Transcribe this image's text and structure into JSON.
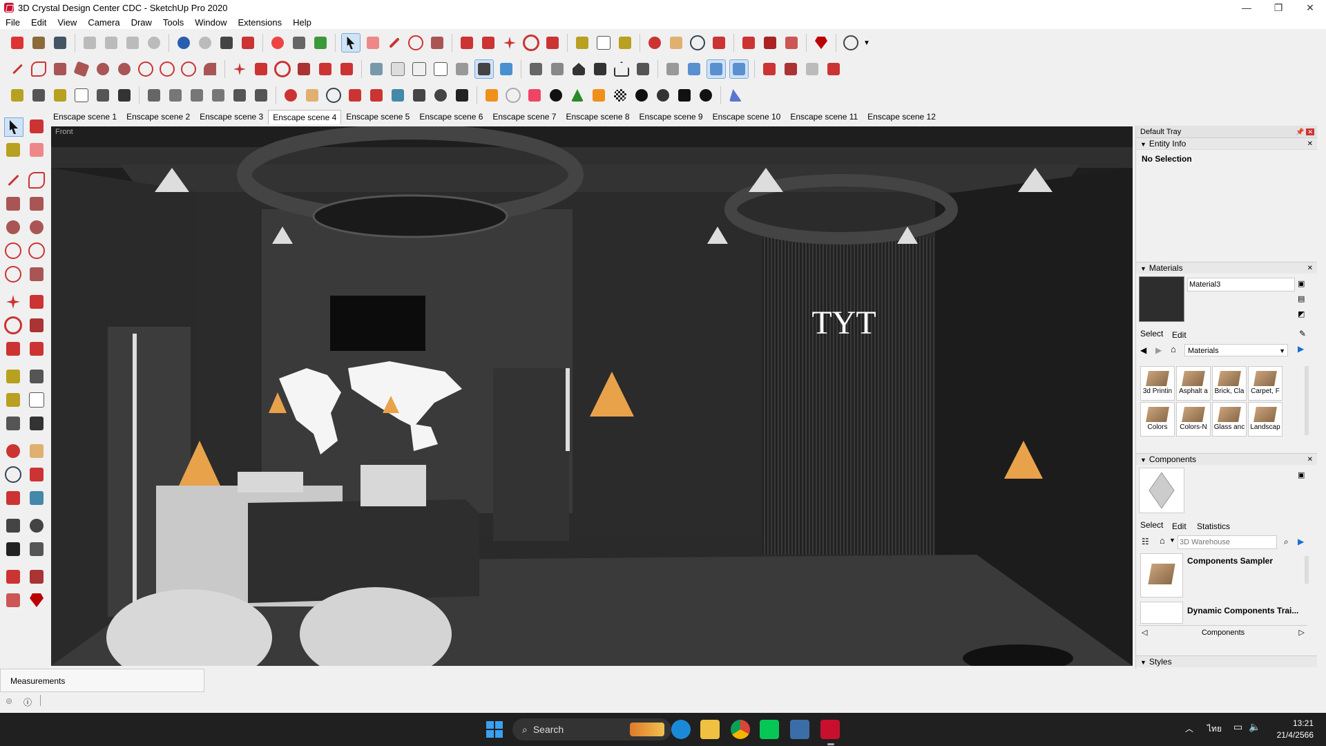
{
  "window": {
    "title": "3D Crystal Design Center CDC - SketchUp Pro 2020"
  },
  "menu": [
    "File",
    "Edit",
    "View",
    "Camera",
    "Draw",
    "Tools",
    "Window",
    "Extensions",
    "Help"
  ],
  "scenes": [
    "Enscape scene 1",
    "Enscape scene 2",
    "Enscape scene 3",
    "Enscape scene 4",
    "Enscape scene 5",
    "Enscape scene 6",
    "Enscape scene 7",
    "Enscape scene 8",
    "Enscape scene 9",
    "Enscape scene 10",
    "Enscape scene 11",
    "Enscape scene 12"
  ],
  "active_scene": "Enscape scene 4",
  "viewport": {
    "view_label": "Front",
    "logo_text": "TYT"
  },
  "tray": {
    "title": "Default Tray",
    "entity_info": {
      "title": "Entity Info",
      "status": "No Selection"
    },
    "materials": {
      "title": "Materials",
      "name": "Material3",
      "tab_select": "Select",
      "tab_edit": "Edit",
      "library": "Materials",
      "items": [
        "3d Printin",
        "Asphalt a",
        "Brick, Cla",
        "Carpet, F",
        "Colors",
        "Colors-N",
        "Glass anc",
        "Landscap"
      ]
    },
    "components": {
      "title": "Components",
      "tab_select": "Select",
      "tab_edit": "Edit",
      "tab_stats": "Statistics",
      "search_placeholder": "3D Warehouse",
      "items": [
        "Components Sampler",
        "Dynamic Components Trai..."
      ],
      "footer": "Components"
    },
    "styles": {
      "title": "Styles"
    }
  },
  "status": {
    "measurements": "Measurements"
  },
  "taskbar": {
    "search": "Search",
    "time": "13:21",
    "date": "21/4/2566",
    "lang": "ไทย"
  },
  "colors": {
    "accent_red": "#c8102e",
    "viewport_bg": "#2a2a2a",
    "lamp": "#e8a24a"
  }
}
